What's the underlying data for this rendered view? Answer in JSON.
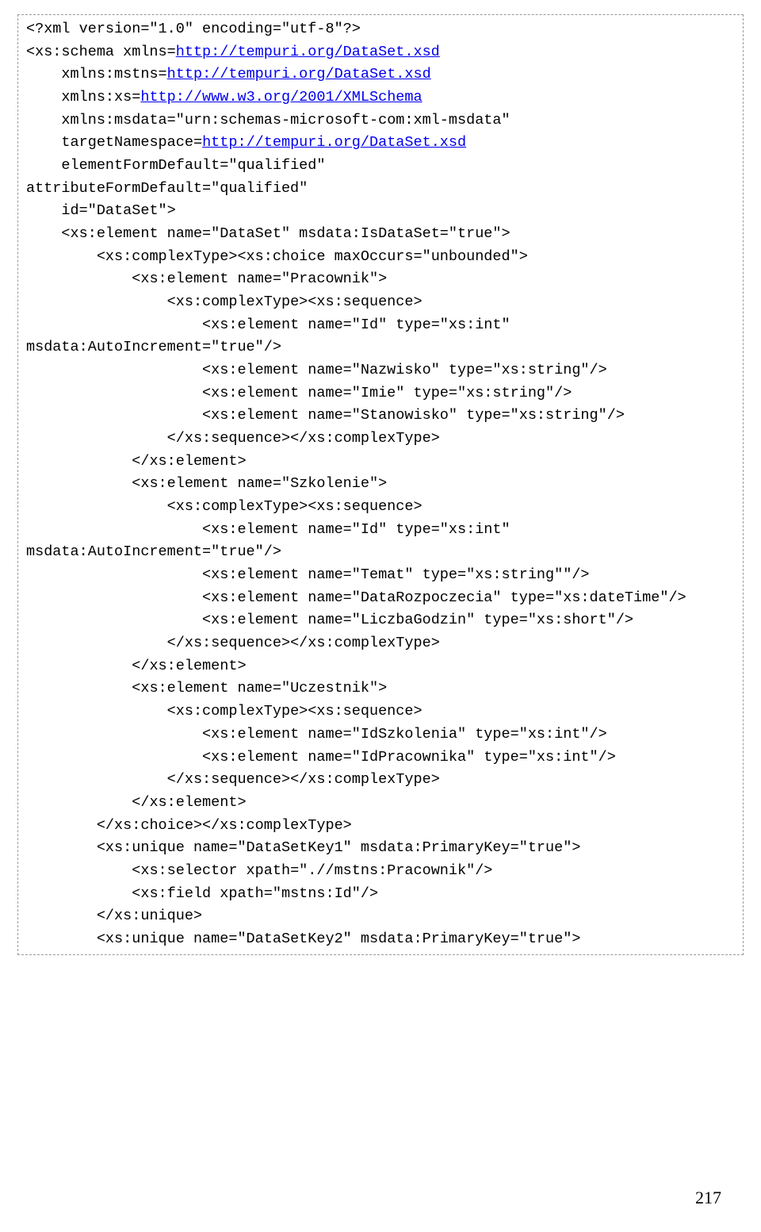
{
  "lines": [
    {
      "segs": [
        {
          "t": "<?xml version=\"1.0\" encoding=\"utf-8\"?>"
        }
      ]
    },
    {
      "segs": [
        {
          "t": "<xs:schema xmlns="
        },
        {
          "t": "http://tempuri.org/DataSet.xsd",
          "link": true
        }
      ]
    },
    {
      "segs": [
        {
          "t": "    xmlns:mstns="
        },
        {
          "t": "http://tempuri.org/DataSet.xsd",
          "link": true
        }
      ]
    },
    {
      "segs": [
        {
          "t": "    xmlns:xs="
        },
        {
          "t": "http://www.w3.org/2001/XMLSchema",
          "link": true
        }
      ]
    },
    {
      "segs": [
        {
          "t": "    xmlns:msdata=\"urn:schemas-microsoft-com:xml-msdata\""
        }
      ]
    },
    {
      "segs": [
        {
          "t": "    targetNamespace="
        },
        {
          "t": "http://tempuri.org/DataSet.xsd",
          "link": true
        }
      ]
    },
    {
      "segs": [
        {
          "t": "    elementFormDefault=\"qualified\""
        }
      ]
    },
    {
      "segs": [
        {
          "t": "attributeFormDefault=\"qualified\""
        }
      ]
    },
    {
      "segs": [
        {
          "t": "    id=\"DataSet\">"
        }
      ]
    },
    {
      "segs": [
        {
          "t": "    <xs:element name=\"DataSet\" msdata:IsDataSet=\"true\">"
        }
      ]
    },
    {
      "segs": [
        {
          "t": "        <xs:complexType><xs:choice maxOccurs=\"unbounded\">"
        }
      ]
    },
    {
      "segs": [
        {
          "t": "            <xs:element name=\"Pracownik\">"
        }
      ]
    },
    {
      "segs": [
        {
          "t": "                <xs:complexType><xs:sequence>"
        }
      ]
    },
    {
      "segs": [
        {
          "t": "                    <xs:element name=\"Id\" type=\"xs:int\" msdata:AutoIncrement=\"true\"/>"
        }
      ]
    },
    {
      "segs": [
        {
          "t": "                    <xs:element name=\"Nazwisko\" type=\"xs:string\"/>"
        }
      ]
    },
    {
      "segs": [
        {
          "t": "                    <xs:element name=\"Imie\" type=\"xs:string\"/>"
        }
      ]
    },
    {
      "segs": [
        {
          "t": "                    <xs:element name=\"Stanowisko\" type=\"xs:string\"/>"
        }
      ]
    },
    {
      "segs": [
        {
          "t": "                </xs:sequence></xs:complexType>"
        }
      ]
    },
    {
      "segs": [
        {
          "t": "            </xs:element>"
        }
      ]
    },
    {
      "segs": [
        {
          "t": "            <xs:element name=\"Szkolenie\">"
        }
      ]
    },
    {
      "segs": [
        {
          "t": "                <xs:complexType><xs:sequence>"
        }
      ]
    },
    {
      "segs": [
        {
          "t": "                    <xs:element name=\"Id\" type=\"xs:int\" msdata:AutoIncrement=\"true\"/>"
        }
      ]
    },
    {
      "segs": [
        {
          "t": "                    <xs:element name=\"Temat\" type=\"xs:string\"\"/>"
        }
      ]
    },
    {
      "segs": [
        {
          "t": "                    <xs:element name=\"DataRozpoczecia\" type=\"xs:dateTime\"/>"
        }
      ]
    },
    {
      "segs": [
        {
          "t": "                    <xs:element name=\"LiczbaGodzin\" type=\"xs:short\"/>"
        }
      ]
    },
    {
      "segs": [
        {
          "t": "                </xs:sequence></xs:complexType>"
        }
      ]
    },
    {
      "segs": [
        {
          "t": "            </xs:element>"
        }
      ]
    },
    {
      "segs": [
        {
          "t": "            <xs:element name=\"Uczestnik\">"
        }
      ]
    },
    {
      "segs": [
        {
          "t": "                <xs:complexType><xs:sequence>"
        }
      ]
    },
    {
      "segs": [
        {
          "t": "                    <xs:element name=\"IdSzkolenia\" type=\"xs:int\"/>"
        }
      ]
    },
    {
      "segs": [
        {
          "t": "                    <xs:element name=\"IdPracownika\" type=\"xs:int\"/>"
        }
      ]
    },
    {
      "segs": [
        {
          "t": "                </xs:sequence></xs:complexType>"
        }
      ]
    },
    {
      "segs": [
        {
          "t": "            </xs:element>"
        }
      ]
    },
    {
      "segs": [
        {
          "t": "        </xs:choice></xs:complexType>"
        }
      ]
    },
    {
      "segs": [
        {
          "t": "        <xs:unique name=\"DataSetKey1\" msdata:PrimaryKey=\"true\">"
        }
      ]
    },
    {
      "segs": [
        {
          "t": "            <xs:selector xpath=\".//mstns:Pracownik\"/>"
        }
      ]
    },
    {
      "segs": [
        {
          "t": "            <xs:field xpath=\"mstns:Id\"/>"
        }
      ]
    },
    {
      "segs": [
        {
          "t": "        </xs:unique>"
        }
      ]
    },
    {
      "segs": [
        {
          "t": "        <xs:unique name=\"DataSetKey2\" msdata:PrimaryKey=\"true\">"
        }
      ]
    }
  ],
  "page_number": "217"
}
